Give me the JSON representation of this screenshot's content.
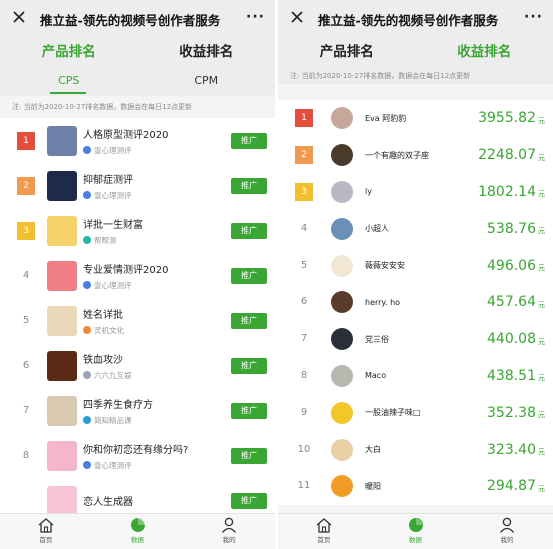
{
  "colors": {
    "accent": "#3aa634",
    "rank1": "#e24f3d",
    "rank2": "#ef9a4e",
    "rank3": "#f1bf2f"
  },
  "left": {
    "title": "推立益-领先的视频号创作者服务",
    "more": "···",
    "tabs": [
      "产品排名",
      "收益排名"
    ],
    "subtabs": [
      "CPS",
      "CPM"
    ],
    "note": "注: 当前为2020-10-27排名数据，数据会在每日12点更新",
    "action_label": "推广",
    "items": [
      {
        "rank": "1",
        "name": "人格原型测评2020",
        "owner": "壹心理测评",
        "thumb": "#6e7fa8",
        "owner_icon": "#4a7ee0"
      },
      {
        "rank": "2",
        "name": "抑郁症测评",
        "owner": "壹心理测评",
        "thumb": "#1f2a4a",
        "owner_icon": "#4a7ee0"
      },
      {
        "rank": "3",
        "name": "详批一生财富",
        "owner": "帮帮测",
        "thumb": "#f5d26a",
        "owner_icon": "#1fb5a8"
      },
      {
        "rank": "4",
        "name": "专业爱情测评2020",
        "owner": "壹心理测评",
        "thumb": "#ef7d84",
        "owner_icon": "#4a7ee0"
      },
      {
        "rank": "5",
        "name": "姓名详批",
        "owner": "灵机文化",
        "thumb": "#e9d9b8",
        "owner_icon": "#f08a3a"
      },
      {
        "rank": "6",
        "name": "铁血攻沙",
        "owner": "六六九互娱",
        "thumb": "#5a2a14",
        "owner_icon": "#9aa4b8"
      },
      {
        "rank": "7",
        "name": "四季养生食疗方",
        "owner": "简知精品课",
        "thumb": "#d8c9b0",
        "owner_icon": "#2c9bd6"
      },
      {
        "rank": "8",
        "name": "你和你初恋还有缘分吗?",
        "owner": "壹心理测评",
        "thumb": "#f3b7c9",
        "owner_icon": "#4a7ee0"
      },
      {
        "rank": "",
        "name": "恋人生成器",
        "owner": "",
        "thumb": "#f6c4d2",
        "owner_icon": "#4a7ee0"
      }
    ],
    "nav": [
      "首页",
      "数据",
      "我的"
    ]
  },
  "right": {
    "title": "推立益-领先的视频号创作者服务",
    "more": "···",
    "tabs": [
      "产品排名",
      "收益排名"
    ],
    "note": "注: 当前为2020-10-27排名数据，数据会在每日12点更新",
    "unit": "元",
    "items": [
      {
        "rank": "1",
        "name": "Eva 阿豹豹",
        "amount": "3955.82",
        "avatar": "#c7a79a"
      },
      {
        "rank": "2",
        "name": "一个有趣的双子座",
        "amount": "2248.07",
        "avatar": "#4a3a2a"
      },
      {
        "rank": "3",
        "name": "ly",
        "amount": "1802.14",
        "avatar": "#b9b9c4"
      },
      {
        "rank": "4",
        "name": "小超人",
        "amount": "538.76",
        "avatar": "#6c8fb8"
      },
      {
        "rank": "5",
        "name": "薇薇安安安",
        "amount": "496.06",
        "avatar": "#f2e7d2"
      },
      {
        "rank": "6",
        "name": "herry. ho",
        "amount": "457.64",
        "avatar": "#5a3b2a"
      },
      {
        "rank": "7",
        "name": "党三俗",
        "amount": "440.08",
        "avatar": "#2a2f3a"
      },
      {
        "rank": "8",
        "name": "Maco",
        "amount": "438.51",
        "avatar": "#b7b7b0"
      },
      {
        "rank": "9",
        "name": "一股油辣子味□",
        "amount": "352.38",
        "avatar": "#f3c62a"
      },
      {
        "rank": "10",
        "name": "大白",
        "amount": "323.40",
        "avatar": "#e9d0a6"
      },
      {
        "rank": "11",
        "name": "暖阳",
        "amount": "294.87",
        "avatar": "#f19c24"
      }
    ],
    "nav": [
      "首页",
      "数据",
      "我的"
    ]
  }
}
